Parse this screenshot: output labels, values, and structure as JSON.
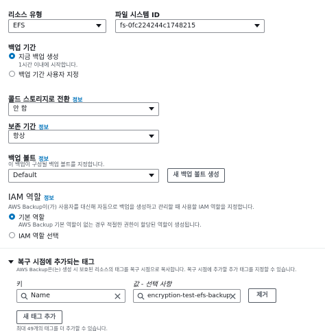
{
  "resource": {
    "type_label": "리소스 유형",
    "type_value": "EFS",
    "fs_label": "파일 시스템 ID",
    "fs_value": "fs-0fc224244c1748215"
  },
  "backup_window": {
    "label": "백업 기간",
    "option1": "지금 백업 생성",
    "option1_desc": "1시간 이내에 시작합니다.",
    "option2": "백업 기간 사용자 지정"
  },
  "cold_storage": {
    "label": "콜드 스토리지로 전환",
    "info": "정보",
    "value": "안 함"
  },
  "retention": {
    "label": "보존 기간",
    "info": "정보",
    "value": "항상"
  },
  "vault": {
    "label": "백업 볼트",
    "info": "정보",
    "desc": "이 백업이 구성될 백업 볼트를 지정합니다.",
    "value": "Default",
    "create_button": "새 백업 볼트 생성"
  },
  "iam": {
    "label": "IAM 역할",
    "info": "정보",
    "desc": "AWS Backup이(가) 사용자를 대신해 자동으로 백업을 생성하고 관리할 때 사용할 IAM 역할을 지정합니다.",
    "option1": "기본 역할",
    "option1_desc": "AWS Backup 기본 역할이 없는 경우 적절한 권한이 할당된 역할이 생성됩니다.",
    "option2": "IAM 역할 선택"
  },
  "tags": {
    "header": "복구 시점에 추가되는 태그",
    "desc": "AWS Backup은(는) 생성 시 보호된 리소스의 태그를 복구 시점으로 복사합니다. 복구 시점에 추가할 추가 태그를 지정할 수 있습니다.",
    "key_label": "키",
    "value_label": "값 - 선택 사항",
    "key_value": "Name",
    "value_value": "encryption-test-efs-backup",
    "remove_button": "제거",
    "add_button": "새 태그 추가",
    "limit_text": "최대 49개의 태그를 더 추가할 수 있습니다."
  },
  "colors": {
    "accent": "#0073bb",
    "text": "#16191f",
    "muted": "#545b64",
    "border": "#8d9096"
  }
}
